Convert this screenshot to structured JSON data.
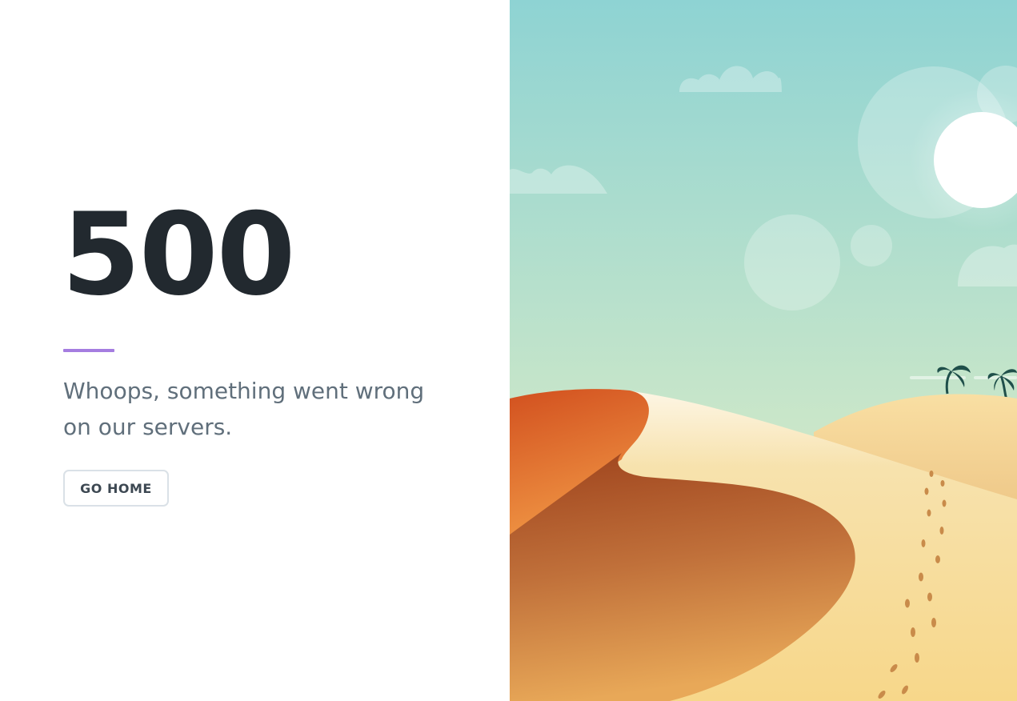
{
  "error": {
    "code": "500",
    "message": "Whoops, something went wrong on our servers."
  },
  "actions": {
    "home_label": "GO HOME"
  },
  "colors": {
    "accent": "#a57de0",
    "heading": "#22292f",
    "message": "#606f7b",
    "sky_top": "#8ed3d3",
    "sky_bottom": "#cfe6c2",
    "dune_red": "#d2501f",
    "dune_brown": "#a0461f",
    "sand": "#f7d98e"
  },
  "illustration": {
    "icon": "desert-illustration",
    "elements": [
      "sun-icon",
      "cloud-icon",
      "palm-tree-icon",
      "footprints-icon",
      "dune-icon"
    ]
  }
}
